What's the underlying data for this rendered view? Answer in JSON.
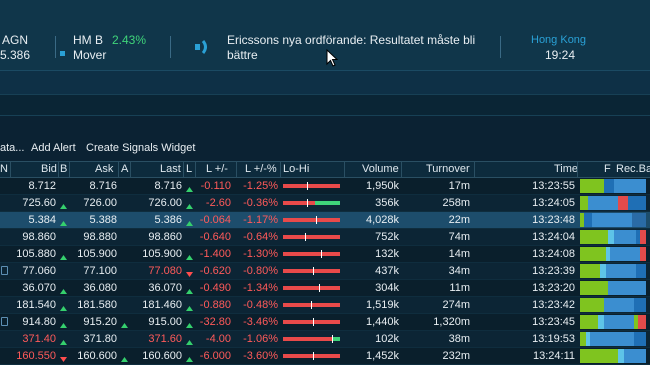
{
  "ticker": {
    "item1": {
      "name": "AGN",
      "price": "5.386"
    },
    "item2": {
      "name": "HM B",
      "change": "2.43%",
      "label": "Mover"
    },
    "news": {
      "line1": "Ericssons nya ordförande: Resultatet måste bli",
      "line2": "bättre"
    },
    "market": {
      "name": "Hong Kong",
      "time": "19:24"
    }
  },
  "toolbar": {
    "partial": "ata...",
    "add_alert": "Add Alert",
    "create_widget": "Create Signals Widget"
  },
  "headers": {
    "n": "N",
    "bid": "Bid",
    "b": "B",
    "ask": "Ask",
    "a": "A",
    "last": "Last",
    "l": "L",
    "lchg": "L +/-",
    "lpct": "L +/-%",
    "lohi": "Lo-Hi",
    "volume": "Volume",
    "turnover": "Turnover",
    "time": "Time",
    "f": "F",
    "recba": "Rec.Ba"
  },
  "rows": [
    {
      "bid": "8.712",
      "ask": "8.716",
      "last": "8.716",
      "chg": "-0.110",
      "pct": "-1.25%",
      "vol": "1,950k",
      "turn": "17m",
      "time": "13:23:55"
    },
    {
      "bid": "725.60",
      "ask": "726.00",
      "last": "726.00",
      "chg": "-2.60",
      "pct": "-0.36%",
      "vol": "356k",
      "turn": "258m",
      "time": "13:24:05"
    },
    {
      "bid": "5.384",
      "ask": "5.388",
      "last": "5.386",
      "chg": "-0.064",
      "pct": "-1.17%",
      "vol": "4,028k",
      "turn": "22m",
      "time": "13:23:48"
    },
    {
      "bid": "98.860",
      "ask": "98.880",
      "last": "98.860",
      "chg": "-0.640",
      "pct": "-0.64%",
      "vol": "752k",
      "turn": "74m",
      "time": "13:24:04"
    },
    {
      "bid": "105.880",
      "ask": "105.900",
      "last": "105.900",
      "chg": "-1.400",
      "pct": "-1.30%",
      "vol": "132k",
      "turn": "14m",
      "time": "13:24:08"
    },
    {
      "bid": "77.060",
      "ask": "77.100",
      "last": "77.080",
      "chg": "-0.620",
      "pct": "-0.80%",
      "vol": "437k",
      "turn": "34m",
      "time": "13:23:39"
    },
    {
      "bid": "36.070",
      "ask": "36.080",
      "last": "36.070",
      "chg": "-0.490",
      "pct": "-1.34%",
      "vol": "304k",
      "turn": "11m",
      "time": "13:23:20"
    },
    {
      "bid": "181.540",
      "ask": "181.580",
      "last": "181.460",
      "chg": "-0.880",
      "pct": "-0.48%",
      "vol": "1,519k",
      "turn": "274m",
      "time": "13:23:42"
    },
    {
      "bid": "914.80",
      "ask": "915.20",
      "last": "915.00",
      "chg": "-32.80",
      "pct": "-3.46%",
      "vol": "1,440k",
      "turn": "1,320m",
      "time": "13:23:45"
    },
    {
      "bid": "371.40",
      "ask": "371.80",
      "last": "371.60",
      "chg": "-4.00",
      "pct": "-1.06%",
      "vol": "102k",
      "turn": "38m",
      "time": "13:19:53"
    },
    {
      "bid": "160.550",
      "ask": "160.600",
      "last": "160.600",
      "chg": "-6.000",
      "pct": "-3.60%",
      "vol": "1,452k",
      "turn": "232m",
      "time": "13:24:11"
    }
  ],
  "colors": {
    "ticker_bg": "#10364a",
    "accent_blue": "#2aa1d6",
    "positive": "#3fd47a",
    "negative": "#ff5a5a",
    "selected_row": "#1d4d6c"
  }
}
